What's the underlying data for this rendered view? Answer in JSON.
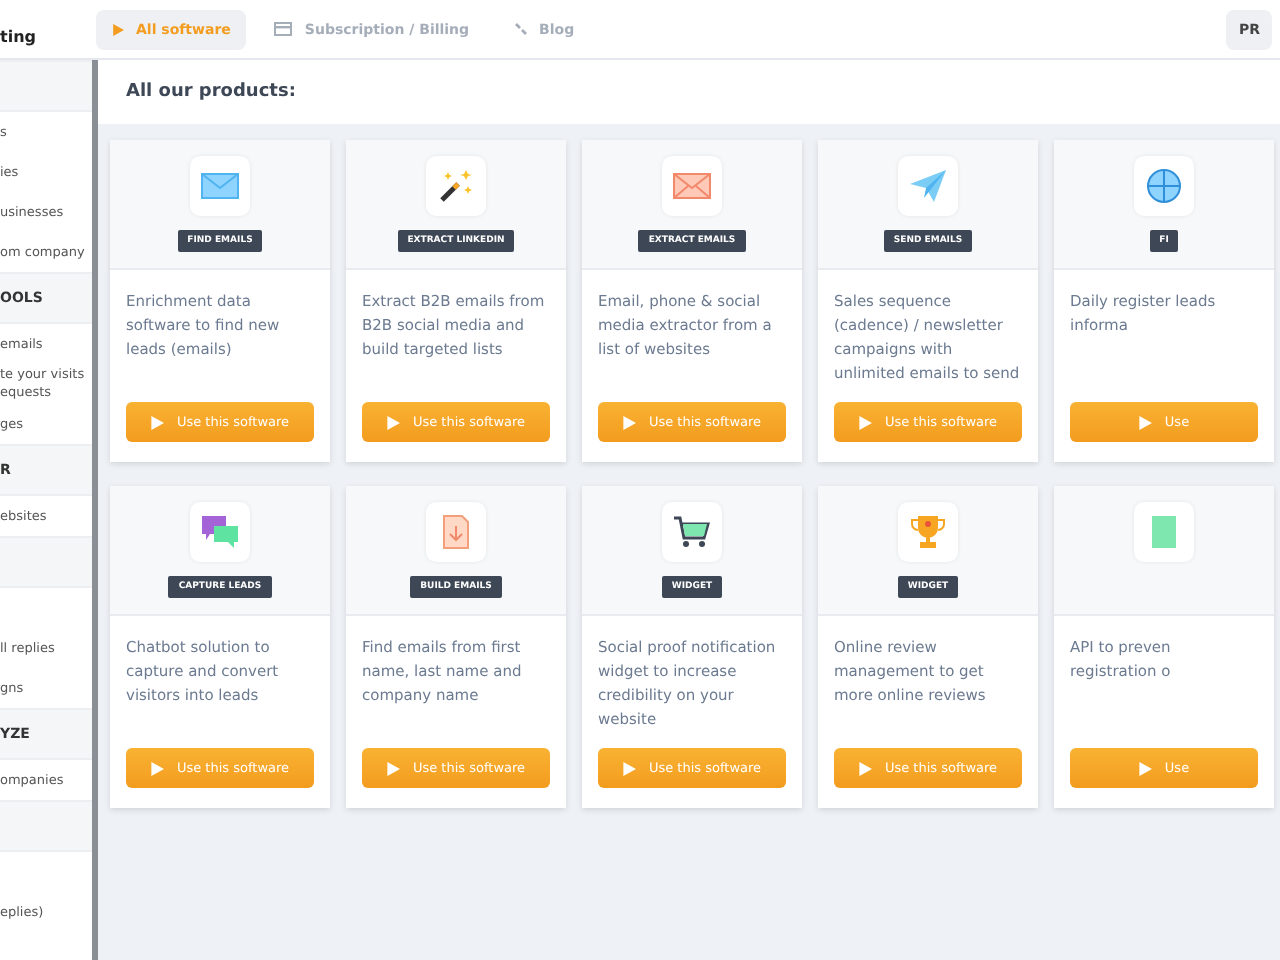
{
  "topbar": {
    "logo": "ting",
    "tabs": [
      {
        "label": "All software",
        "kind": "play",
        "selected": true
      },
      {
        "label": "Subscription / Billing",
        "kind": "card",
        "selected": false
      },
      {
        "label": "Blog",
        "kind": "link",
        "selected": false
      }
    ],
    "right_button": "PR"
  },
  "sidebar": {
    "sections": [
      {
        "items": [
          "s",
          "ies",
          "usinesses",
          "om company"
        ]
      },
      {
        "title": "OOLS",
        "items": [
          "emails",
          "te your visits equests",
          "ges"
        ]
      },
      {
        "title": "R",
        "items": [
          "ebsites"
        ]
      },
      {
        "items": [
          "ll replies",
          "gns"
        ]
      },
      {
        "title": "YZE",
        "items": [
          "ompanies"
        ]
      },
      {
        "items": [
          "eplies)"
        ]
      }
    ]
  },
  "heading": "All our products:",
  "products": [
    {
      "kind": "envelope-blue",
      "tag": "FIND EMAILS",
      "description": "Enrichment data software to find new leads (emails)",
      "button": "Use this software"
    },
    {
      "kind": "wand",
      "tag": "EXTRACT LINKEDIN",
      "description": "Extract B2B emails from B2B social media and build targeted lists",
      "button": "Use this software"
    },
    {
      "kind": "envelope-red",
      "tag": "EXTRACT EMAILS",
      "description": "Email, phone & social media extractor from a list of websites",
      "button": "Use this software"
    },
    {
      "kind": "plane",
      "tag": "SEND EMAILS",
      "description": "Sales sequence (cadence) / newsletter campaigns with unlimited emails to send",
      "button": "Use this software"
    },
    {
      "kind": "globe",
      "tag": "FI",
      "description": "Daily register leads informa",
      "button": "Use"
    },
    {
      "kind": "chat",
      "tag": "CAPTURE LEADS",
      "description": "Chatbot solution to capture and convert visitors into leads",
      "button": "Use this software"
    },
    {
      "kind": "file",
      "tag": "BUILD EMAILS",
      "description": "Find emails from first name, last name and company name",
      "button": "Use this software"
    },
    {
      "kind": "cart",
      "tag": "WIDGET",
      "description": "Social proof notification widget to increase credibility on your website",
      "button": "Use this software"
    },
    {
      "kind": "trophy",
      "tag": "WIDGET",
      "description": "Online review management to get more online reviews",
      "button": "Use this software"
    },
    {
      "kind": "sheet",
      "description": "API to preven registration o",
      "button": "Use"
    }
  ]
}
